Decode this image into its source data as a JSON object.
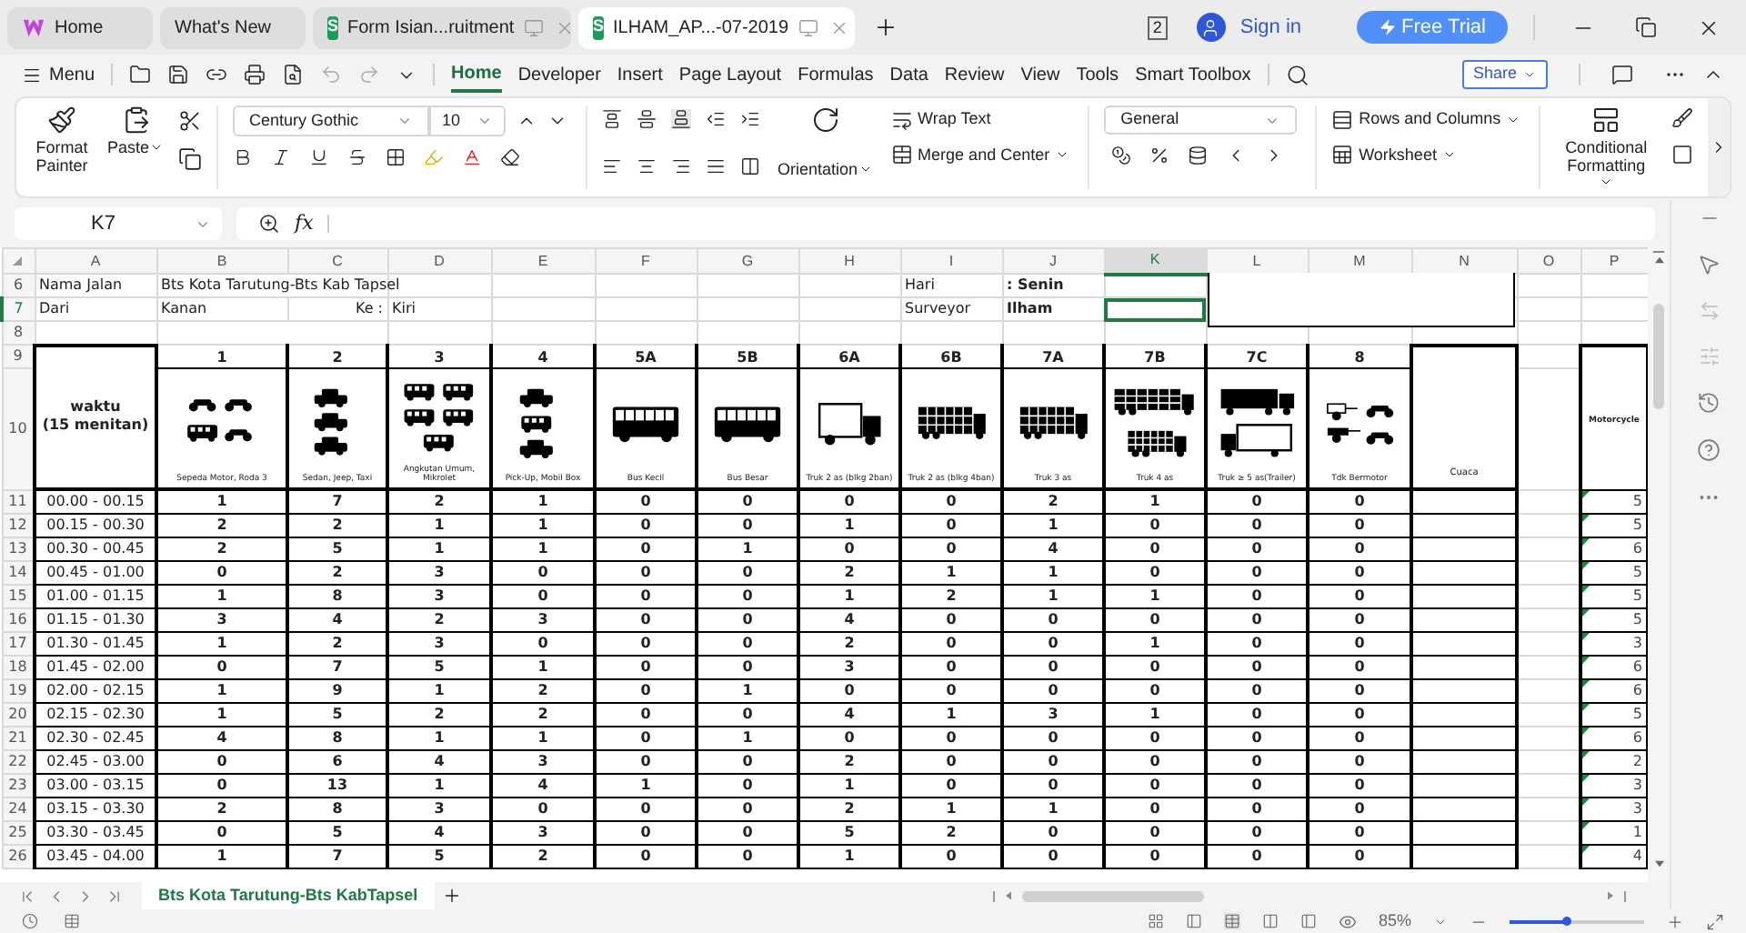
{
  "browser_tabs": [
    {
      "label": "Home",
      "kind": "home",
      "selected": false
    },
    {
      "label": "What's New",
      "kind": "plain",
      "selected": false
    },
    {
      "label": "Form Isian...ruitment",
      "kind": "sheet",
      "badge": "S",
      "selected": false
    },
    {
      "label": "ILHAM_AP...-07-2019",
      "kind": "sheet",
      "badge": "S",
      "selected": true
    }
  ],
  "title_bar": {
    "window_count": "2",
    "sign_in": "Sign in",
    "free_trial": "Free Trial"
  },
  "menu": {
    "label": "Menu"
  },
  "ribbon_tabs": [
    {
      "label": "Home",
      "selected": true
    },
    {
      "label": "Developer",
      "selected": false
    },
    {
      "label": "Insert",
      "selected": false
    },
    {
      "label": "Page Layout",
      "selected": false
    },
    {
      "label": "Formulas",
      "selected": false
    },
    {
      "label": "Data",
      "selected": false
    },
    {
      "label": "Review",
      "selected": false
    },
    {
      "label": "View",
      "selected": false
    },
    {
      "label": "Tools",
      "selected": false
    },
    {
      "label": "Smart Toolbox",
      "selected": false
    }
  ],
  "share": "Share",
  "ribbon": {
    "format_painter": "Format Painter",
    "paste": "Paste",
    "font": "Century Gothic",
    "font_size": "10",
    "orientation": "Orientation",
    "wrap_text": "Wrap Text",
    "merge_center": "Merge and Center",
    "number_format": "General",
    "rows_columns": "Rows and Columns",
    "worksheet": "Worksheet",
    "conditional_formatting": "Conditional Formatting"
  },
  "formula_bar": {
    "cell_ref": "K7",
    "fx": "fx"
  },
  "columns": [
    {
      "label": "A",
      "selected": false
    },
    {
      "label": "B",
      "selected": false
    },
    {
      "label": "C",
      "selected": false
    },
    {
      "label": "D",
      "selected": false
    },
    {
      "label": "E",
      "selected": false
    },
    {
      "label": "F",
      "selected": false
    },
    {
      "label": "G",
      "selected": false
    },
    {
      "label": "H",
      "selected": false
    },
    {
      "label": "I",
      "selected": false
    },
    {
      "label": "J",
      "selected": false
    },
    {
      "label": "K",
      "selected": true
    },
    {
      "label": "L",
      "selected": false
    },
    {
      "label": "M",
      "selected": false
    },
    {
      "label": "N",
      "selected": false
    },
    {
      "label": "O",
      "selected": false
    },
    {
      "label": "P",
      "selected": false
    }
  ],
  "info_rows": [
    {
      "number": "6",
      "selected": false,
      "label": "Nama Jalan",
      "value": "Bts Kota Tarutung-Bts Kab Tapsel",
      "right_label": "Hari",
      "right_value": ": Senin"
    },
    {
      "number": "7",
      "selected": true,
      "label": "Dari",
      "value": "Kanan",
      "mid_label": "Ke :",
      "mid_value": "Kiri",
      "right_label": "Surveyor",
      "right_value": "Ilham"
    },
    {
      "number": "8",
      "selected": false
    }
  ],
  "header_row_numbers": [
    "9",
    "10"
  ],
  "time_header": "waktu\n(15 menitan)",
  "vehicle_classes": [
    {
      "code": "1",
      "label": "Sepeda Motor, Roda 3",
      "kind": "motorcycle"
    },
    {
      "code": "2",
      "label": "Sedan, Jeep, Taxi",
      "kind": "car"
    },
    {
      "code": "3",
      "label": "Angkutan Umum, Mikrolet",
      "kind": "minibus"
    },
    {
      "code": "4",
      "label": "Pick-Up, Mobil Box",
      "kind": "pickup"
    },
    {
      "code": "5A",
      "label": "Bus Kecil",
      "kind": "bus"
    },
    {
      "code": "5B",
      "label": "Bus Besar",
      "kind": "bus"
    },
    {
      "code": "6A",
      "label": "Truk 2 as  (blkg 2ban)",
      "kind": "truck"
    },
    {
      "code": "6B",
      "label": "Truk 2 as  (blkg 4ban)",
      "kind": "cargo"
    },
    {
      "code": "7A",
      "label": "Truk 3 as",
      "kind": "cargo"
    },
    {
      "code": "7B",
      "label": "Truk 4 as",
      "kind": "trailer"
    },
    {
      "code": "7C",
      "label": "Truk ≥ 5 as(Trailer)",
      "kind": "semi"
    },
    {
      "code": "8",
      "label": "Tdk Bermotor",
      "kind": "nonmotor"
    }
  ],
  "weather_header": "Cuaca",
  "extra_header": "Motorcycle",
  "rows": [
    {
      "number": "11",
      "time": "00.00 - 00.15",
      "counts": [
        "1",
        "7",
        "2",
        "1",
        "0",
        "0",
        "0",
        "0",
        "2",
        "1",
        "0",
        "0"
      ],
      "extra": "5"
    },
    {
      "number": "12",
      "time": "00.15 - 00.30",
      "counts": [
        "2",
        "2",
        "1",
        "1",
        "0",
        "0",
        "1",
        "0",
        "1",
        "0",
        "0",
        "0"
      ],
      "extra": "5"
    },
    {
      "number": "13",
      "time": "00.30 - 00.45",
      "counts": [
        "2",
        "5",
        "1",
        "1",
        "0",
        "1",
        "0",
        "0",
        "4",
        "0",
        "0",
        "0"
      ],
      "extra": "6"
    },
    {
      "number": "14",
      "time": "00.45 - 01.00",
      "counts": [
        "0",
        "2",
        "3",
        "0",
        "0",
        "0",
        "2",
        "1",
        "1",
        "0",
        "0",
        "0"
      ],
      "extra": "5"
    },
    {
      "number": "15",
      "time": "01.00 - 01.15",
      "counts": [
        "1",
        "8",
        "3",
        "0",
        "0",
        "0",
        "1",
        "2",
        "1",
        "1",
        "0",
        "0"
      ],
      "extra": "5"
    },
    {
      "number": "16",
      "time": "01.15 - 01.30",
      "counts": [
        "3",
        "4",
        "2",
        "3",
        "0",
        "0",
        "4",
        "0",
        "0",
        "0",
        "0",
        "0"
      ],
      "extra": "5"
    },
    {
      "number": "17",
      "time": "01.30 - 01.45",
      "counts": [
        "1",
        "2",
        "3",
        "0",
        "0",
        "0",
        "2",
        "0",
        "0",
        "1",
        "0",
        "0"
      ],
      "extra": "3"
    },
    {
      "number": "18",
      "time": "01.45 - 02.00",
      "counts": [
        "0",
        "7",
        "5",
        "1",
        "0",
        "0",
        "3",
        "0",
        "0",
        "0",
        "0",
        "0"
      ],
      "extra": "6"
    },
    {
      "number": "19",
      "time": "02.00 - 02.15",
      "counts": [
        "1",
        "9",
        "1",
        "2",
        "0",
        "1",
        "0",
        "0",
        "0",
        "0",
        "0",
        "0"
      ],
      "extra": "6"
    },
    {
      "number": "20",
      "time": "02.15 - 02.30",
      "counts": [
        "1",
        "5",
        "2",
        "2",
        "0",
        "0",
        "4",
        "1",
        "3",
        "1",
        "0",
        "0"
      ],
      "extra": "5"
    },
    {
      "number": "21",
      "time": "02.30 - 02.45",
      "counts": [
        "4",
        "8",
        "1",
        "1",
        "0",
        "1",
        "0",
        "0",
        "0",
        "0",
        "0",
        "0"
      ],
      "extra": "6"
    },
    {
      "number": "22",
      "time": "02.45 - 03.00",
      "counts": [
        "0",
        "6",
        "4",
        "3",
        "0",
        "0",
        "2",
        "0",
        "0",
        "0",
        "0",
        "0"
      ],
      "extra": "2"
    },
    {
      "number": "23",
      "time": "03.00 - 03.15",
      "counts": [
        "0",
        "13",
        "1",
        "4",
        "1",
        "0",
        "1",
        "0",
        "0",
        "0",
        "0",
        "0"
      ],
      "extra": "3"
    },
    {
      "number": "24",
      "time": "03.15 - 03.30",
      "counts": [
        "2",
        "8",
        "3",
        "0",
        "0",
        "0",
        "2",
        "1",
        "1",
        "0",
        "0",
        "0"
      ],
      "extra": "3"
    },
    {
      "number": "25",
      "time": "03.30 - 03.45",
      "counts": [
        "0",
        "5",
        "4",
        "3",
        "0",
        "0",
        "5",
        "2",
        "0",
        "0",
        "0",
        "0"
      ],
      "extra": "1"
    },
    {
      "number": "26",
      "time": "03.45 - 04.00",
      "counts": [
        "1",
        "7",
        "5",
        "2",
        "0",
        "0",
        "1",
        "0",
        "0",
        "0",
        "0",
        "0"
      ],
      "extra": "4"
    }
  ],
  "sheet_tabs": [
    {
      "label": "Bts Kota Tarutung-Bts KabTapsel",
      "selected": true
    }
  ],
  "status_bar": {
    "zoom": "85%",
    "level": 0.42
  }
}
